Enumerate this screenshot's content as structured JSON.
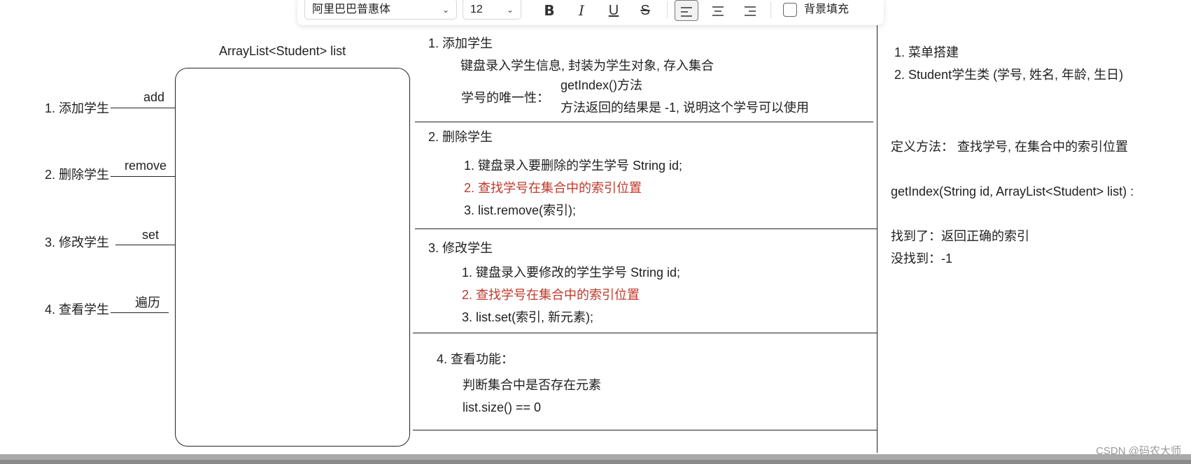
{
  "toolbar": {
    "font_family": "阿里巴巴普惠体",
    "font_size": "12",
    "bold_label": "B",
    "italic_label": "I",
    "underline_label": "U",
    "strike_label": "S",
    "bg_fill_label": "背景填充"
  },
  "diagram": {
    "list_title": "ArrayList<Student>  list",
    "left_items": [
      {
        "label": "1. 添加学生",
        "op": "add"
      },
      {
        "label": "2. 删除学生",
        "op": "remove"
      },
      {
        "label": "3. 修改学生",
        "op": "set"
      },
      {
        "label": "4. 查看学生",
        "op": "遍历"
      }
    ]
  },
  "sections": {
    "add": {
      "title": "1. 添加学生",
      "line1": "键盘录入学生信息, 封装为学生对象, 存入集合",
      "unique_label": "学号的唯一性：",
      "unique_1": "getIndex()方法",
      "unique_2": "方法返回的结果是 -1, 说明这个学号可以使用"
    },
    "remove": {
      "title": "2. 删除学生",
      "step1": "1. 键盘录入要删除的学生学号  String id;",
      "step2": "2. 查找学号在集合中的索引位置",
      "step3": "3. list.remove(索引);"
    },
    "modify": {
      "title": "3. 修改学生",
      "step1": "1. 键盘录入要修改的学生学号   String id;",
      "step2": "2. 查找学号在集合中的索引位置",
      "step3": "3. list.set(索引, 新元素);"
    },
    "view": {
      "title": "4. 查看功能：",
      "line1": "判断集合中是否存在元素",
      "line2": "list.size() == 0"
    }
  },
  "right_panel": {
    "item1": "1. 菜单搭建",
    "item2": "2. Student学生类 (学号, 姓名, 年龄, 生日)",
    "define": "定义方法： 查找学号, 在集合中的索引位置",
    "signature": "getIndex(String id, ArrayList<Student> list) :",
    "found": "找到了：返回正确的索引",
    "not_found": "没找到：-1"
  },
  "watermark": "CSDN @码农大师"
}
